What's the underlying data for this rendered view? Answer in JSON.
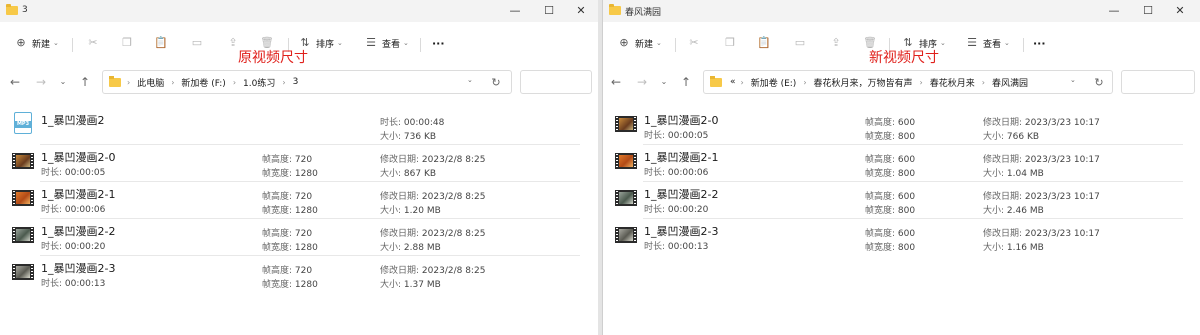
{
  "left": {
    "title": "3",
    "window_controls": {
      "minimize": "—",
      "maximize": "☐",
      "close": "✕"
    },
    "toolbar": {
      "new_label": "新建",
      "sort_label": "排序",
      "view_label": "查看",
      "more_label": "···"
    },
    "annotation": "原视频尺寸",
    "breadcrumb": [
      "此电脑",
      "新加卷 (F:)",
      "1.0练习",
      "3"
    ],
    "files": [
      {
        "name": "1_暴凹漫画2",
        "icon": "mp3-icon",
        "duration_key": "时长:",
        "duration": "00:00:48",
        "size_key": "大小:",
        "size": "736 KB"
      },
      {
        "name": "1_暴凹漫画2-0",
        "icon": "video-icon",
        "duration_key": "时长:",
        "duration": "00:00:05",
        "h_key": "帧高度:",
        "height": "720",
        "w_key": "帧宽度:",
        "width": "1280",
        "date_key": "修改日期:",
        "date": "2023/2/8 8:25",
        "size_key": "大小:",
        "size": "867 KB"
      },
      {
        "name": "1_暴凹漫画2-1",
        "icon": "video-icon",
        "duration_key": "时长:",
        "duration": "00:00:06",
        "h_key": "帧高度:",
        "height": "720",
        "w_key": "帧宽度:",
        "width": "1280",
        "date_key": "修改日期:",
        "date": "2023/2/8 8:25",
        "size_key": "大小:",
        "size": "1.20 MB"
      },
      {
        "name": "1_暴凹漫画2-2",
        "icon": "video-icon",
        "duration_key": "时长:",
        "duration": "00:00:20",
        "h_key": "帧高度:",
        "height": "720",
        "w_key": "帧宽度:",
        "width": "1280",
        "date_key": "修改日期:",
        "date": "2023/2/8 8:25",
        "size_key": "大小:",
        "size": "2.88 MB"
      },
      {
        "name": "1_暴凹漫画2-3",
        "icon": "video-icon",
        "duration_key": "时长:",
        "duration": "00:00:13",
        "h_key": "帧高度:",
        "height": "720",
        "w_key": "帧宽度:",
        "width": "1280",
        "date_key": "修改日期:",
        "date": "2023/2/8 8:25",
        "size_key": "大小:",
        "size": "1.37 MB"
      }
    ]
  },
  "right": {
    "title": "春风满园",
    "window_controls": {
      "minimize": "—",
      "maximize": "☐",
      "close": "✕"
    },
    "toolbar": {
      "new_label": "新建",
      "sort_label": "排序",
      "view_label": "查看",
      "more_label": "···"
    },
    "annotation": "新视频尺寸",
    "breadcrumb_prefix": "«",
    "breadcrumb": [
      "新加卷 (E:)",
      "春花秋月来，万物皆有声",
      "春花秋月来",
      "春风满园"
    ],
    "files": [
      {
        "name": "1_暴凹漫画2-0",
        "icon": "video-icon",
        "duration_key": "时长:",
        "duration": "00:00:05",
        "h_key": "帧高度:",
        "height": "600",
        "w_key": "帧宽度:",
        "width": "800",
        "date_key": "修改日期:",
        "date": "2023/3/23 10:17",
        "size_key": "大小:",
        "size": "766 KB"
      },
      {
        "name": "1_暴凹漫画2-1",
        "icon": "video-icon",
        "duration_key": "时长:",
        "duration": "00:00:06",
        "h_key": "帧高度:",
        "height": "600",
        "w_key": "帧宽度:",
        "width": "800",
        "date_key": "修改日期:",
        "date": "2023/3/23 10:17",
        "size_key": "大小:",
        "size": "1.04 MB"
      },
      {
        "name": "1_暴凹漫画2-2",
        "icon": "video-icon",
        "duration_key": "时长:",
        "duration": "00:00:20",
        "h_key": "帧高度:",
        "height": "600",
        "w_key": "帧宽度:",
        "width": "800",
        "date_key": "修改日期:",
        "date": "2023/3/23 10:17",
        "size_key": "大小:",
        "size": "2.46 MB"
      },
      {
        "name": "1_暴凹漫画2-3",
        "icon": "video-icon",
        "duration_key": "时长:",
        "duration": "00:00:13",
        "h_key": "帧高度:",
        "height": "600",
        "w_key": "帧宽度:",
        "width": "800",
        "date_key": "修改日期:",
        "date": "2023/3/23 10:17",
        "size_key": "大小:",
        "size": "1.16 MB"
      }
    ]
  }
}
